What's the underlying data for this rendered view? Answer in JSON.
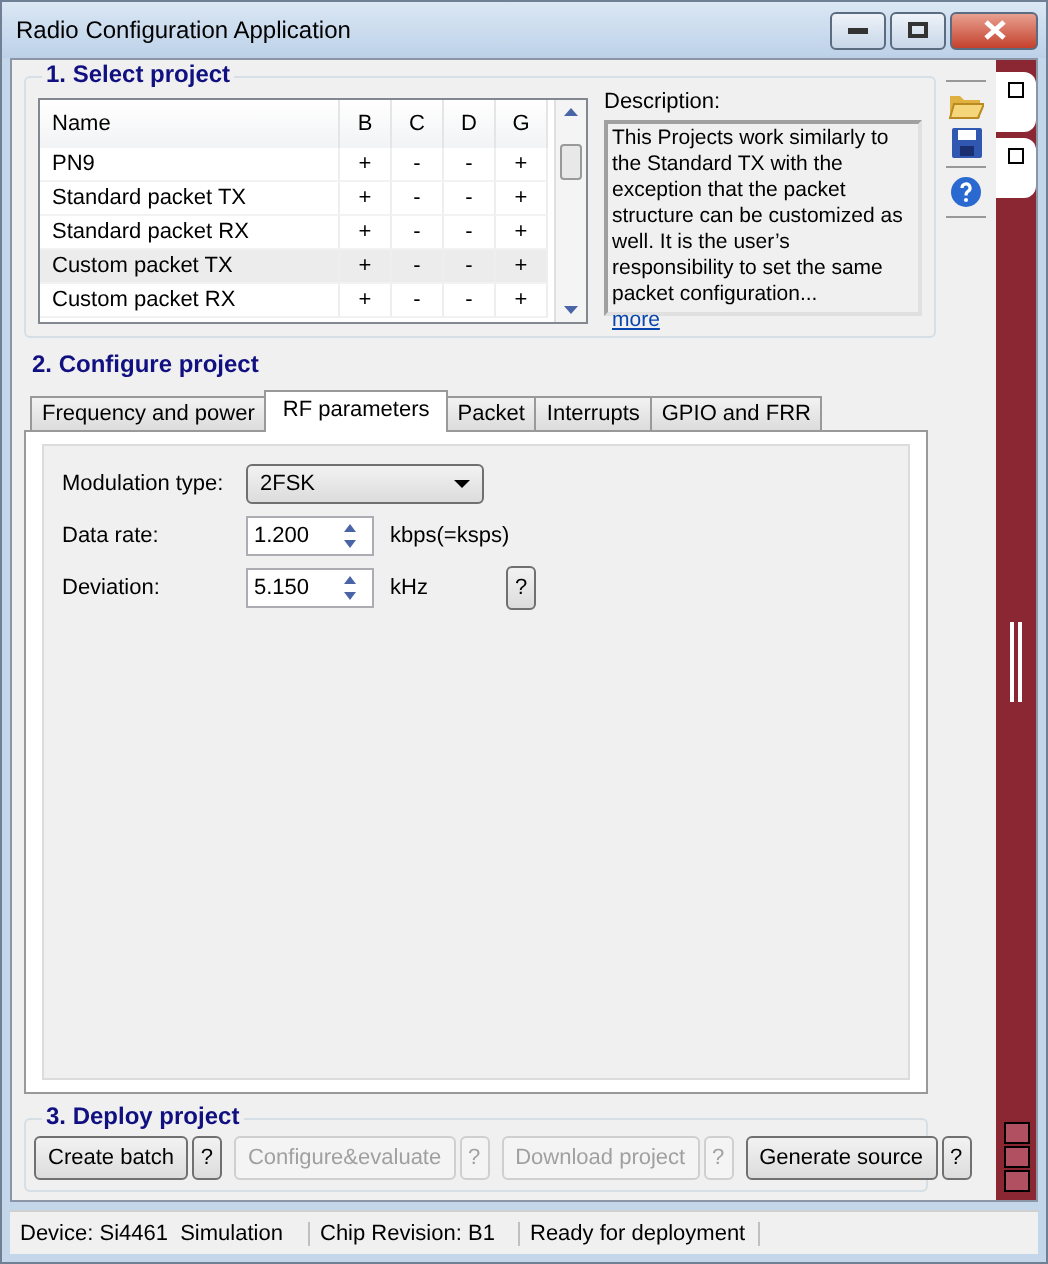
{
  "window": {
    "title": "Radio Configuration Application"
  },
  "select_project": {
    "title": "1. Select project",
    "columns": [
      "Name",
      "B",
      "C",
      "D",
      "G"
    ],
    "rows": [
      {
        "cells": [
          "PN9",
          "+",
          "-",
          "-",
          "+"
        ],
        "selected": false
      },
      {
        "cells": [
          "Standard packet TX",
          "+",
          "-",
          "-",
          "+"
        ],
        "selected": false
      },
      {
        "cells": [
          "Standard packet RX",
          "+",
          "-",
          "-",
          "+"
        ],
        "selected": false
      },
      {
        "cells": [
          "Custom packet TX",
          "+",
          "-",
          "-",
          "+"
        ],
        "selected": true
      },
      {
        "cells": [
          "Custom packet RX",
          "+",
          "-",
          "-",
          "+"
        ],
        "selected": false
      }
    ],
    "description_label": "Description:",
    "description": "This Projects work similarly to the Standard TX with the exception that the packet structure can be customized as well. It is the user’s responsibility to set the same packet configuration...",
    "more_link": "more"
  },
  "configure_project": {
    "title": "2. Configure project",
    "tabs": [
      {
        "label": "Frequency and power",
        "selected": false
      },
      {
        "label": "RF parameters",
        "selected": true
      },
      {
        "label": "Packet",
        "selected": false
      },
      {
        "label": "Interrupts",
        "selected": false
      },
      {
        "label": "GPIO and FRR",
        "selected": false
      }
    ],
    "fields": [
      {
        "kind": "dropdown",
        "label": "Modulation type:",
        "value": "2FSK"
      },
      {
        "kind": "spin",
        "label": "Data rate:",
        "value": "1.200",
        "unit": "kbps(=ksps)"
      },
      {
        "kind": "spin",
        "label": "Deviation:",
        "value": "5.150",
        "unit": "kHz",
        "help": "?"
      }
    ]
  },
  "deploy_project": {
    "title": "3. Deploy project",
    "buttons": [
      {
        "label": "Create batch",
        "help": "?",
        "disabled": false
      },
      {
        "label": "Configure&evaluate",
        "help": "?",
        "disabled": true
      },
      {
        "label": "Download project",
        "help": "?",
        "disabled": true
      },
      {
        "label": "Generate source",
        "help": "?",
        "disabled": false
      }
    ]
  },
  "status_bar": [
    "Device: Si4461  Simulation",
    "Chip Revision: B1",
    "Ready for deployment"
  ]
}
